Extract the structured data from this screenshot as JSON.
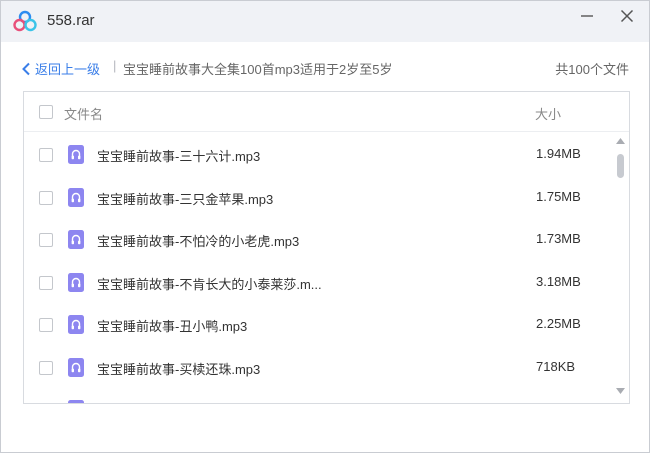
{
  "window": {
    "title": "558.rar"
  },
  "toolbar": {
    "back_label": "返回上一级",
    "separator": "|",
    "folder_path": "宝宝睡前故事大全集100首mp3适用于2岁至5岁",
    "file_count": "共100个文件"
  },
  "list": {
    "columns": {
      "name": "文件名",
      "size": "大小"
    },
    "items": [
      {
        "name": "宝宝睡前故事-三十六计.mp3",
        "size": "1.94MB"
      },
      {
        "name": "宝宝睡前故事-三只金苹果.mp3",
        "size": "1.75MB"
      },
      {
        "name": "宝宝睡前故事-不怕冷的小老虎.mp3",
        "size": "1.73MB"
      },
      {
        "name": "宝宝睡前故事-不肯长大的小泰莱莎.m...",
        "size": "3.18MB"
      },
      {
        "name": "宝宝睡前故事-丑小鸭.mp3",
        "size": "2.25MB"
      },
      {
        "name": "宝宝睡前故事-买椟还珠.mp3",
        "size": "718KB"
      }
    ]
  },
  "icons": {
    "file_type": "audio-file-icon",
    "app": "cloud-logo-icon"
  },
  "colors": {
    "accent": "#3a7ee8",
    "audio_icon": "#8d86f0",
    "titlebar_bg": "#f0f2f6"
  }
}
